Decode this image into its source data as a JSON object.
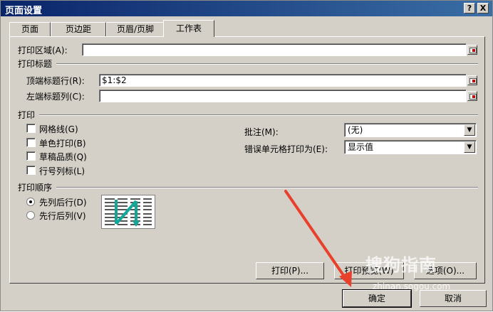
{
  "window": {
    "title": "页面设置",
    "help_btn": "?",
    "close_btn": "X"
  },
  "tabs": [
    {
      "label": "页面",
      "active": false
    },
    {
      "label": "页边距",
      "active": false
    },
    {
      "label": "页眉/页脚",
      "active": false
    },
    {
      "label": "工作表",
      "active": true
    }
  ],
  "print_area": {
    "label": "打印区域(A):",
    "value": ""
  },
  "print_titles": {
    "group_label": "打印标题",
    "rows_label": "顶端标题行(R):",
    "rows_value": "$1:$2",
    "cols_label": "左端标题列(C):",
    "cols_value": ""
  },
  "print": {
    "group_label": "打印",
    "gridlines": {
      "label": "网格线(G)",
      "checked": false
    },
    "bw": {
      "label": "单色打印(B)",
      "checked": false
    },
    "draft": {
      "label": "草稿品质(Q)",
      "checked": false
    },
    "headings": {
      "label": "行号列标(L)",
      "checked": false
    },
    "comments_label": "批注(M):",
    "comments_value": "(无)",
    "errors_label": "错误单元格打印为(E):",
    "errors_value": "显示值"
  },
  "page_order": {
    "group_label": "打印顺序",
    "down_then_over": {
      "label": "先列后行(D)",
      "selected": true
    },
    "over_then_down": {
      "label": "先行后列(V)",
      "selected": false
    }
  },
  "buttons": {
    "print": "打印(P)...",
    "preview": "打印预览(W)",
    "options": "选项(O)...",
    "ok": "确定",
    "cancel": "取消"
  },
  "watermark": {
    "text": "搜狗指南",
    "url": "zhinan.sogou.com"
  },
  "colors": {
    "titlebar": "#0a246a",
    "dialog": "#d4d0c8",
    "arrow": "#e8402a",
    "order_teal": "#13a79a"
  }
}
